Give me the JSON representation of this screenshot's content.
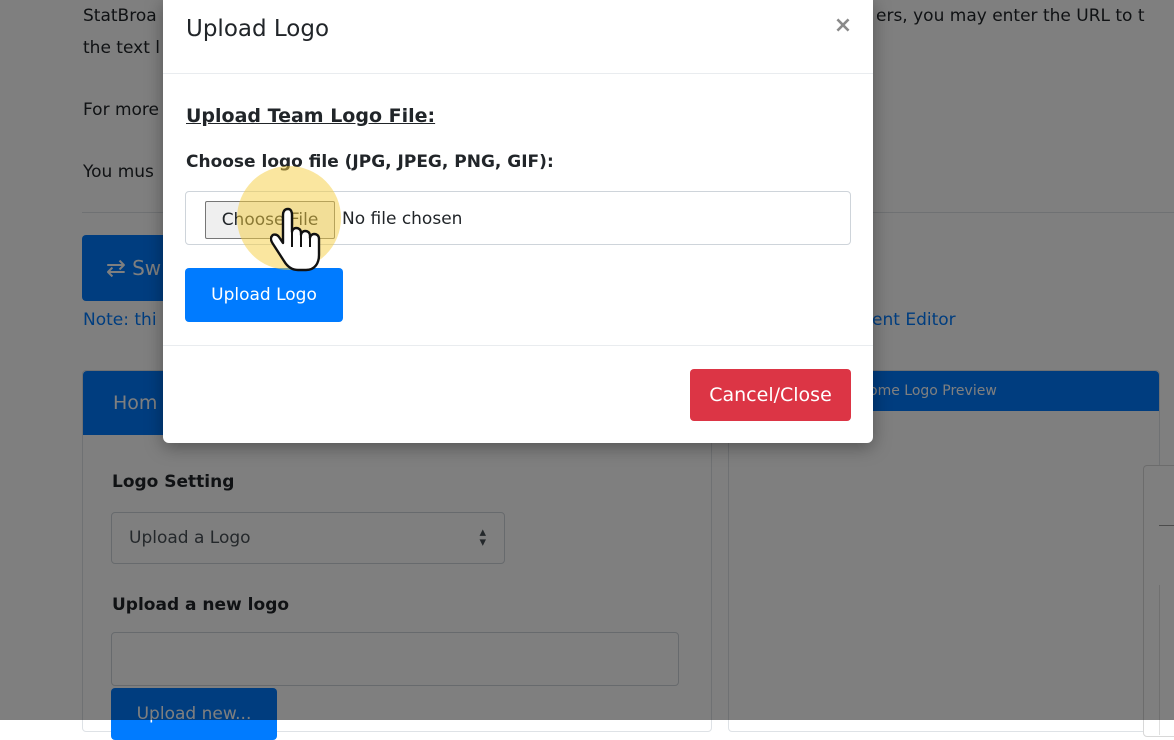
{
  "background": {
    "intro_line1_left": "StatBroa",
    "intro_line1_right": "ers, you may enter the URL to t",
    "intro_line2": "the text l",
    "for_more": "For more",
    "you_must": "You mus",
    "swap_button_label": "Sw",
    "note_text": "Note: thi",
    "note_link": "vent Editor",
    "home_card_title": "Hom",
    "home_logo_preview_title": "ome Logo Preview",
    "logo_setting_label": "Logo Setting",
    "logo_setting_value": "Upload a Logo",
    "upload_new_logo_label": "Upload a new logo",
    "upload_new_button": "Upload new..."
  },
  "modal": {
    "title": "Upload Logo",
    "close_symbol": "×",
    "section_heading": "Upload Team Logo File:",
    "file_label": "Choose logo file (JPG, JPEG, PNG, GIF):",
    "choose_file_button": "Choose File",
    "no_file_text": "No file chosen",
    "upload_button": "Upload Logo",
    "cancel_button": "Cancel/Close"
  },
  "icons": {
    "swap": "swap-arrows-icon",
    "select_arrows": "sort-arrows-icon",
    "cursor": "hand-pointer-cursor-icon"
  },
  "colors": {
    "primary": "#007bff",
    "danger": "#dc3545",
    "click_highlight": "#f6ce40"
  }
}
